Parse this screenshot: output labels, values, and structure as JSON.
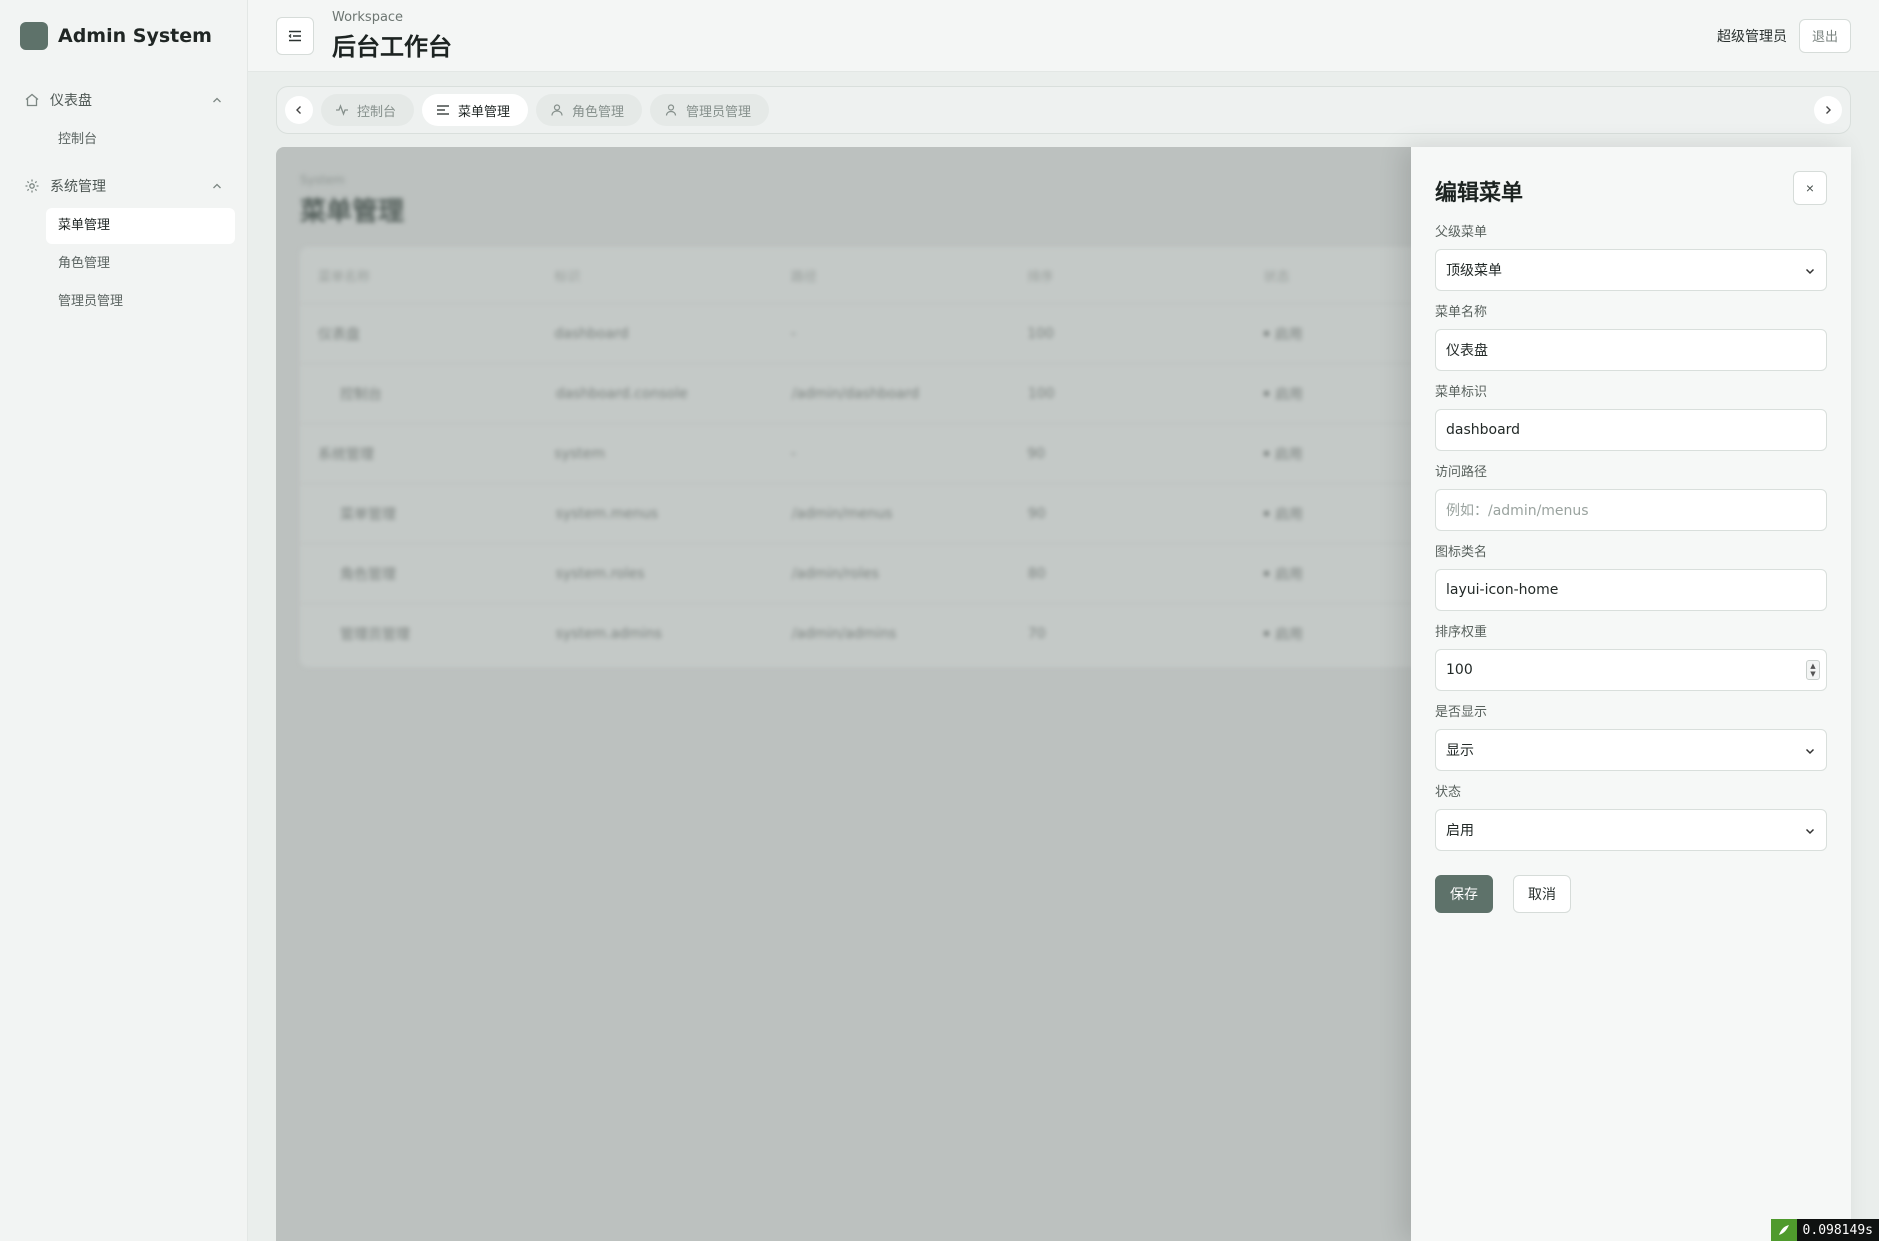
{
  "brand": {
    "name": "Admin System"
  },
  "sidebar": {
    "groups": [
      {
        "label": "仪表盘",
        "items": [
          {
            "label": "控制台"
          }
        ]
      },
      {
        "label": "系统管理",
        "items": [
          {
            "label": "菜单管理"
          },
          {
            "label": "角色管理"
          },
          {
            "label": "管理员管理"
          }
        ]
      }
    ],
    "active_item": "菜单管理"
  },
  "header": {
    "workspace": "Workspace",
    "title": "后台工作台",
    "user_name": "超级管理员",
    "logout_label": "退出"
  },
  "tabs": [
    {
      "label": "控制台",
      "icon": "pulse-icon",
      "active": false
    },
    {
      "label": "菜单管理",
      "icon": "menu-list-icon",
      "active": true
    },
    {
      "label": "角色管理",
      "icon": "users-icon",
      "active": false
    },
    {
      "label": "管理员管理",
      "icon": "user-icon",
      "active": false
    }
  ],
  "background_page": {
    "section_label": "System",
    "title": "菜单管理",
    "columns": [
      "菜单名称",
      "标识",
      "路径",
      "排序",
      "状态"
    ],
    "rows": [
      {
        "name": "仪表盘",
        "key": "dashboard",
        "path": "-",
        "sort": "100",
        "status": "启用"
      },
      {
        "name": "控制台",
        "key": "dashboard.console",
        "path": "/admin/dashboard",
        "sort": "100",
        "status": "启用"
      },
      {
        "name": "系统管理",
        "key": "system",
        "path": "-",
        "sort": "90",
        "status": "启用"
      },
      {
        "name": "菜单管理",
        "key": "system.menus",
        "path": "/admin/menus",
        "sort": "90",
        "status": "启用"
      },
      {
        "name": "角色管理",
        "key": "system.roles",
        "path": "/admin/roles",
        "sort": "80",
        "status": "启用"
      },
      {
        "name": "管理员管理",
        "key": "system.admins",
        "path": "/admin/admins",
        "sort": "70",
        "status": "启用"
      }
    ]
  },
  "drawer": {
    "title": "编辑菜单",
    "close_label": "×",
    "fields": {
      "parent": {
        "label": "父级菜单",
        "value": "顶级菜单"
      },
      "name": {
        "label": "菜单名称",
        "value": "仪表盘"
      },
      "key": {
        "label": "菜单标识",
        "value": "dashboard"
      },
      "path": {
        "label": "访问路径",
        "value": "",
        "placeholder": "例如：/admin/menus"
      },
      "icon": {
        "label": "图标类名",
        "value": "layui-icon-home"
      },
      "sort": {
        "label": "排序权重",
        "value": "100"
      },
      "visible": {
        "label": "是否显示",
        "value": "显示"
      },
      "status": {
        "label": "状态",
        "value": "启用"
      }
    },
    "save_label": "保存",
    "cancel_label": "取消"
  },
  "debug": {
    "time": "0.098149s"
  },
  "colors": {
    "accent": "#5e726a",
    "sidebar_bg": "#f2f4f3",
    "overlay": "#bcc1bf"
  }
}
